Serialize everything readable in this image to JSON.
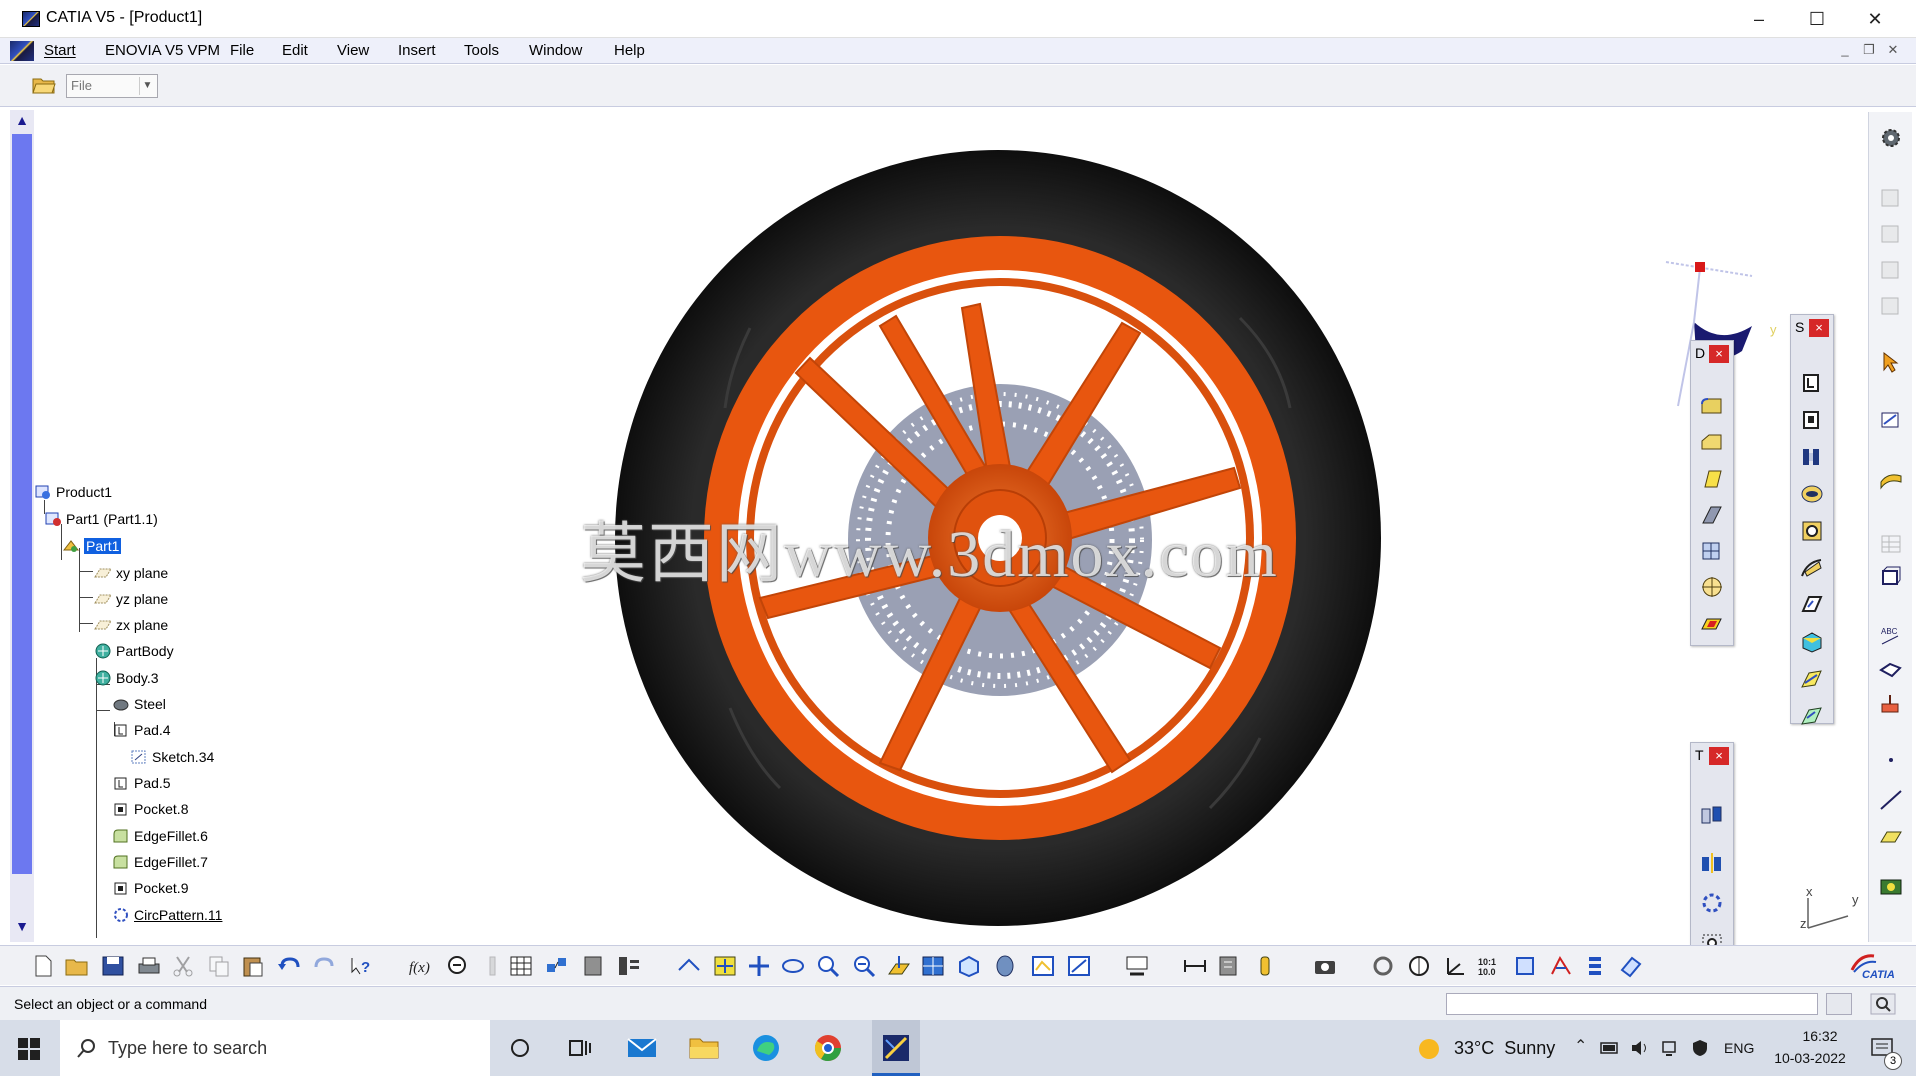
{
  "window": {
    "title": "CATIA V5 - [Product1]",
    "minimize": "–",
    "maximize": "☐",
    "close": "✕"
  },
  "menu": {
    "items": [
      "Start",
      "ENOVIA V5 VPM",
      "File",
      "Edit",
      "View",
      "Insert",
      "Tools",
      "Window",
      "Help"
    ],
    "mdi_min": "_",
    "mdi_restore": "❐",
    "mdi_close": "✕"
  },
  "toolbar": {
    "file_combo": "File"
  },
  "tree": {
    "nodes": [
      {
        "label": "Product1",
        "icon": "product-icon"
      },
      {
        "label": "Part1 (Part1.1)",
        "icon": "part-instance-icon"
      },
      {
        "label": "Part1",
        "icon": "part-icon",
        "selected": true
      },
      {
        "label": "xy plane",
        "icon": "plane-icon"
      },
      {
        "label": "yz plane",
        "icon": "plane-icon"
      },
      {
        "label": "zx plane",
        "icon": "plane-icon"
      },
      {
        "label": "PartBody",
        "icon": "body-icon"
      },
      {
        "label": "Body.3",
        "icon": "body-icon"
      },
      {
        "label": "Steel",
        "icon": "material-icon"
      },
      {
        "label": "Pad.4",
        "icon": "pad-icon"
      },
      {
        "label": "Sketch.34",
        "icon": "sketch-icon"
      },
      {
        "label": "Pad.5",
        "icon": "pad-icon"
      },
      {
        "label": "Pocket.8",
        "icon": "pocket-icon"
      },
      {
        "label": "EdgeFillet.6",
        "icon": "fillet-icon"
      },
      {
        "label": "EdgeFillet.7",
        "icon": "fillet-icon"
      },
      {
        "label": "Pocket.9",
        "icon": "pocket-icon"
      },
      {
        "label": "CircPattern.11",
        "icon": "pattern-icon"
      }
    ]
  },
  "viewport": {
    "watermark": "莫西网www.3dmox.com",
    "compass_label_y": "y",
    "axis_x": "x",
    "axis_y": "y",
    "axis_z": "z",
    "colors": {
      "tire": "#1f1f1f",
      "rim": "#e8560f",
      "disc": "#9aa0b4",
      "hub": "#d84a0c"
    }
  },
  "panels": {
    "dress_up": {
      "title": "D",
      "close": "×"
    },
    "sketch_based": {
      "title": "S",
      "close": "×"
    },
    "transform": {
      "title": "T",
      "close": "×"
    }
  },
  "status": {
    "prompt": "Select an object or a command"
  },
  "brand": {
    "logo_text": "CATIA"
  },
  "taskbar": {
    "search_placeholder": "Type here to search",
    "weather": "33°C  Sunny",
    "language": "ENG",
    "time": "16:32",
    "date": "10-03-2022",
    "notifications": "3"
  }
}
